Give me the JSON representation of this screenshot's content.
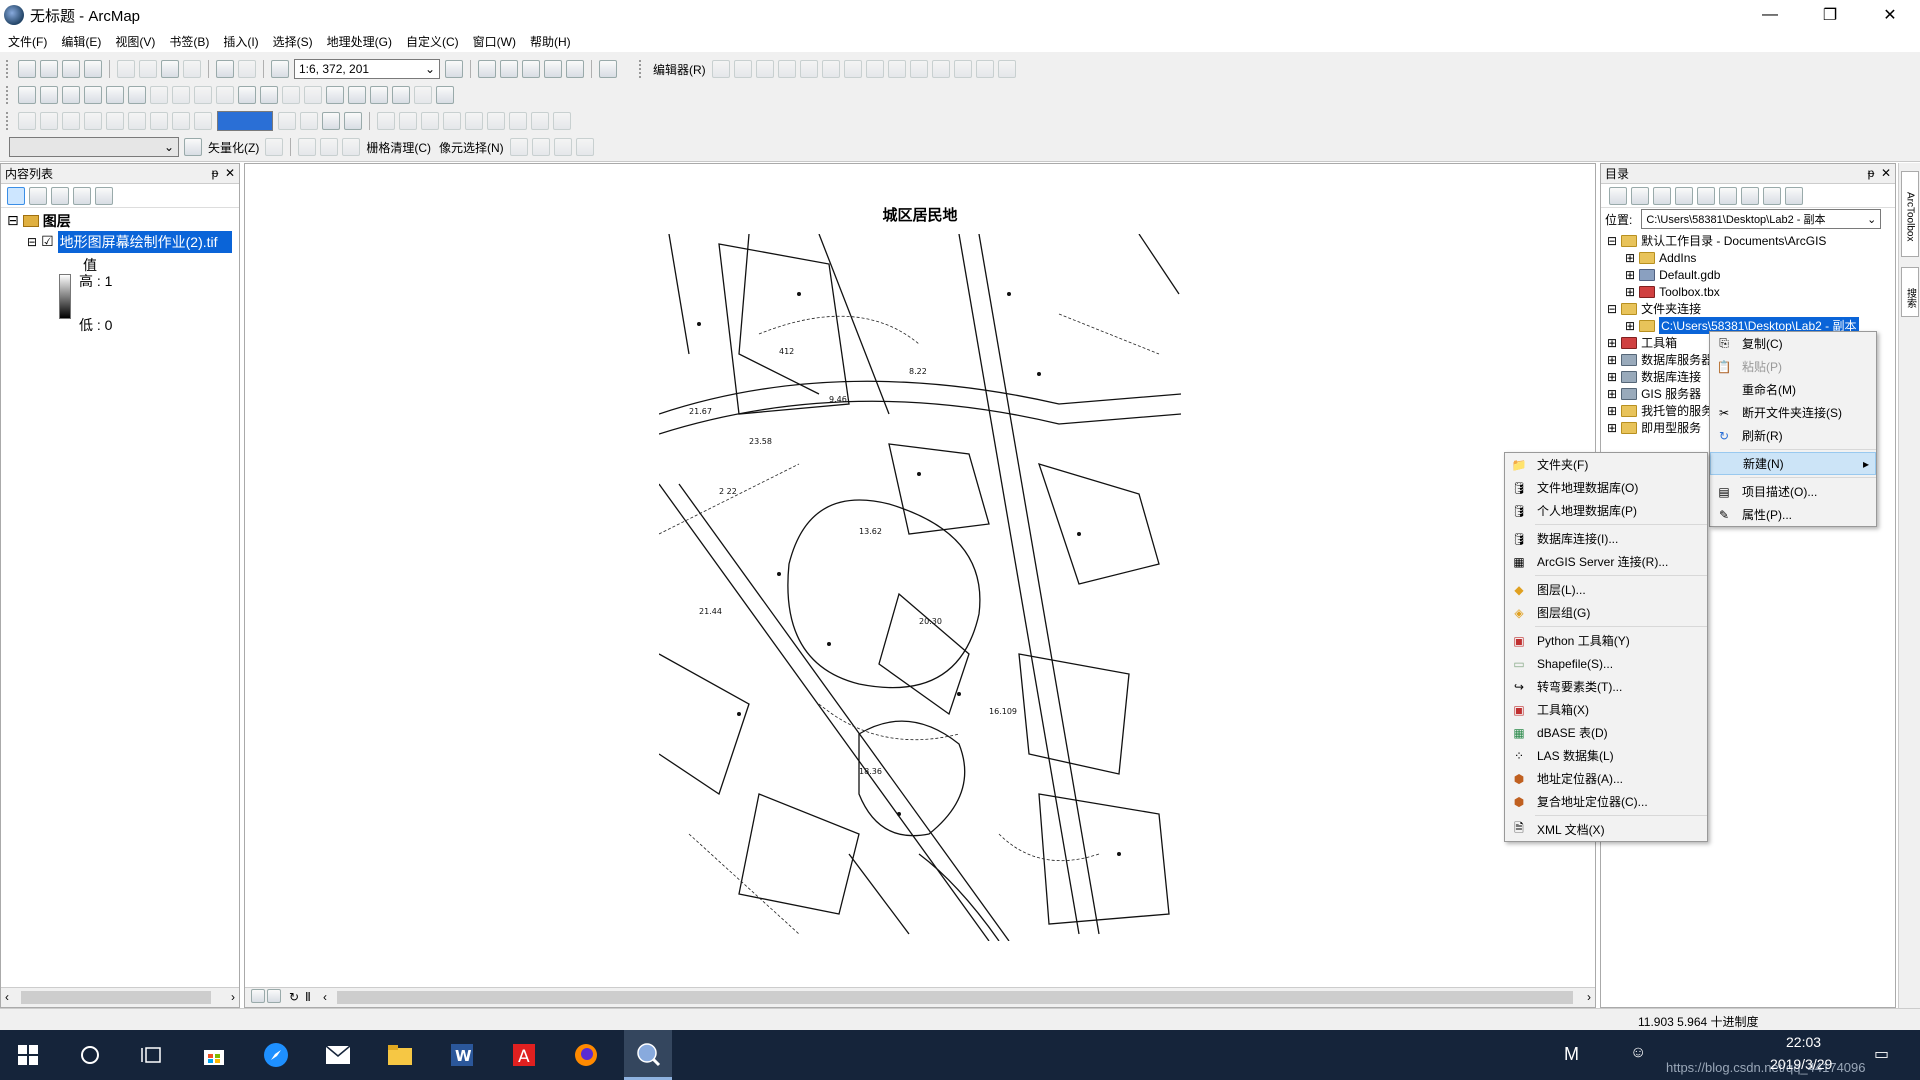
{
  "window": {
    "title": "无标题 - ArcMap",
    "min": "—",
    "max": "❐",
    "close": "✕"
  },
  "menu": [
    "文件(F)",
    "编辑(E)",
    "视图(V)",
    "书签(B)",
    "插入(I)",
    "选择(S)",
    "地理处理(G)",
    "自定义(C)",
    "窗口(W)",
    "帮助(H)"
  ],
  "toolbar": {
    "scale": "1:6, 372, 201",
    "editor": "编辑器(R)",
    "vectorize": "矢量化(Z)",
    "raster_cleanup": "栅格清理(C)",
    "cell_select": "像元选择(N)"
  },
  "toc": {
    "header": "内容列表",
    "pin": "ᵽ",
    "close": "✕",
    "layers_root": "图层",
    "layer_name": "地形图屏幕绘制作业(2).tif",
    "legend_value": "值",
    "legend_high": "高 : 1",
    "legend_low": "低 : 0",
    "expander": "⊟",
    "checked": "☑"
  },
  "map": {
    "title": "城区居民地"
  },
  "catalog": {
    "header": "目录",
    "location_label": "位置:",
    "location_value": "C:\\Users\\58381\\Desktop\\Lab2 - 副本",
    "tree": [
      {
        "label": "默认工作目录 - Documents\\ArcGIS",
        "level": 0,
        "exp": "⊟"
      },
      {
        "label": "AddIns",
        "level": 1,
        "exp": "⊞"
      },
      {
        "label": "Default.gdb",
        "level": 1,
        "exp": "⊞"
      },
      {
        "label": "Toolbox.tbx",
        "level": 1,
        "exp": "⊞"
      },
      {
        "label": "文件夹连接",
        "level": 0,
        "exp": "⊟"
      },
      {
        "label": "C:\\Users\\58381\\Desktop\\Lab2 - 副本",
        "level": 1,
        "exp": "⊞",
        "selected": true
      },
      {
        "label": "工具箱",
        "level": 0,
        "exp": "⊞"
      },
      {
        "label": "数据库服务器",
        "level": 0,
        "exp": "⊞"
      },
      {
        "label": "数据库连接",
        "level": 0,
        "exp": "⊞"
      },
      {
        "label": "GIS 服务器",
        "level": 0,
        "exp": "⊞"
      },
      {
        "label": "我托管的服务",
        "level": 0,
        "exp": "⊞"
      },
      {
        "label": "即用型服务",
        "level": 0,
        "exp": "⊞"
      }
    ]
  },
  "context_menu": {
    "items": [
      {
        "label": "复制(C)",
        "icon": "copy-icon",
        "glyph": "⎘"
      },
      {
        "label": "粘贴(P)",
        "icon": "paste-icon",
        "glyph": "📋",
        "disabled": true
      },
      {
        "label": "重命名(M)",
        "icon": "",
        "glyph": ""
      },
      {
        "label": "断开文件夹连接(S)",
        "icon": "disconnect-folder-icon",
        "glyph": "✂"
      },
      {
        "label": "刷新(R)",
        "icon": "refresh-icon",
        "glyph": "↻"
      },
      {
        "label": "新建(N)",
        "icon": "",
        "glyph": "",
        "highlighted": true,
        "arrow": "▸"
      },
      {
        "label": "项目描述(O)...",
        "icon": "item-description-icon",
        "glyph": "▤"
      },
      {
        "label": "属性(P)...",
        "icon": "properties-icon",
        "glyph": "✎"
      }
    ]
  },
  "submenu": {
    "items": [
      {
        "label": "文件夹(F)",
        "icon": "folder-icon",
        "glyph": "📁"
      },
      {
        "label": "文件地理数据库(O)",
        "icon": "file-gdb-icon",
        "glyph": "🛢"
      },
      {
        "label": "个人地理数据库(P)",
        "icon": "personal-gdb-icon",
        "glyph": "🛢"
      },
      {
        "label": "数据库连接(I)...",
        "icon": "db-connection-icon",
        "glyph": "🛢",
        "sep": true
      },
      {
        "label": "ArcGIS Server 连接(R)...",
        "icon": "server-connection-icon",
        "glyph": "▦"
      },
      {
        "label": "图层(L)...",
        "icon": "layer-icon",
        "glyph": "◆",
        "sep": true
      },
      {
        "label": "图层组(G)",
        "icon": "group-layer-icon",
        "glyph": "◈"
      },
      {
        "label": "Python 工具箱(Y)",
        "icon": "python-toolbox-icon",
        "glyph": "▣",
        "sep": true
      },
      {
        "label": "Shapefile(S)...",
        "icon": "shapefile-icon",
        "glyph": "▭"
      },
      {
        "label": "转弯要素类(T)...",
        "icon": "turn-feature-icon",
        "glyph": "↪"
      },
      {
        "label": "工具箱(X)",
        "icon": "toolbox-icon",
        "glyph": "▣"
      },
      {
        "label": "dBASE 表(D)",
        "icon": "dbase-table-icon",
        "glyph": "▦"
      },
      {
        "label": "LAS 数据集(L)",
        "icon": "las-dataset-icon",
        "glyph": "⁘"
      },
      {
        "label": "地址定位器(A)...",
        "icon": "address-locator-icon",
        "glyph": "⬢"
      },
      {
        "label": "复合地址定位器(C)...",
        "icon": "composite-locator-icon",
        "glyph": "⬢"
      },
      {
        "label": "XML 文档(X)",
        "icon": "xml-document-icon",
        "glyph": "🗎",
        "sep": true
      }
    ]
  },
  "right_strip": {
    "arctoolbox": "ArcToolbox",
    "search": "搜索"
  },
  "status": {
    "coords": "11.903  5.964 十进制度"
  },
  "taskbar": {
    "time": "22:03",
    "date": "2019/3/29",
    "watermark": "https://blog.csdn.net/qq_44174096",
    "ime": "M"
  }
}
